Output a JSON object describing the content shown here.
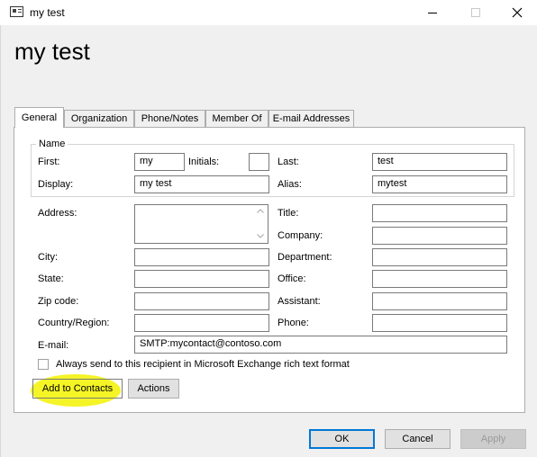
{
  "window": {
    "title": "my test",
    "icon": "contact-card-icon",
    "controls": [
      "minimize-icon",
      "maximize-icon",
      "close-icon"
    ]
  },
  "header": {
    "title": "my test"
  },
  "tabs": [
    {
      "label": "General",
      "active": true
    },
    {
      "label": "Organization",
      "active": false
    },
    {
      "label": "Phone/Notes",
      "active": false
    },
    {
      "label": "Member Of",
      "active": false
    },
    {
      "label": "E-mail Addresses",
      "active": false
    }
  ],
  "name_group": {
    "legend": "Name",
    "first_label": "First:",
    "first_value": "my",
    "initials_label": "Initials:",
    "initials_value": "",
    "last_label": "Last:",
    "last_value": "test",
    "display_label": "Display:",
    "display_value": "my test",
    "alias_label": "Alias:",
    "alias_value": "mytest"
  },
  "fields": {
    "address_label": "Address:",
    "address_value": "",
    "city_label": "City:",
    "state_label": "State:",
    "zip_label": "Zip code:",
    "country_label": "Country/Region:",
    "email_label": "E-mail:",
    "email_value": "SMTP:mycontact@contoso.com",
    "title_label": "Title:",
    "company_label": "Company:",
    "department_label": "Department:",
    "office_label": "Office:",
    "assistant_label": "Assistant:",
    "phone_label": "Phone:"
  },
  "rich_text": {
    "label": "Always send to this recipient in Microsoft Exchange rich text format",
    "checked": false
  },
  "buttons": {
    "add_to_contacts": "Add to Contacts",
    "actions": "Actions",
    "ok": "OK",
    "cancel": "Cancel",
    "apply": "Apply"
  },
  "colors": {
    "highlight": "#f3f200",
    "accent": "#0078d7",
    "panel_border": "#adadad"
  }
}
